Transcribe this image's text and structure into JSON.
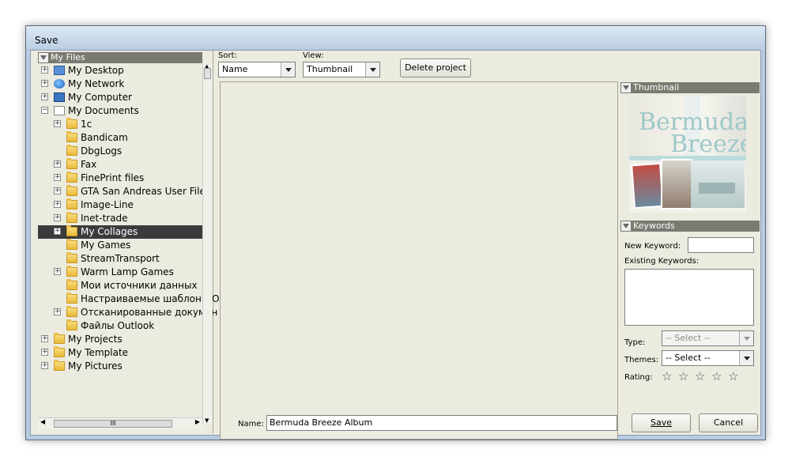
{
  "window": {
    "title": "Save"
  },
  "tree": {
    "header": "My Files",
    "items": [
      {
        "label": "My Desktop",
        "expander": "+",
        "icon": "desktop-icon"
      },
      {
        "label": "My Network",
        "expander": "+",
        "icon": "network-icon"
      },
      {
        "label": "My Computer",
        "expander": "+",
        "icon": "computer-icon"
      },
      {
        "label": "My Documents",
        "expander": "−",
        "icon": "documents-icon"
      },
      {
        "label": "1c",
        "expander": "+",
        "icon": "folder-icon"
      },
      {
        "label": "Bandicam",
        "expander": "",
        "icon": "folder-icon"
      },
      {
        "label": "DbgLogs",
        "expander": "",
        "icon": "folder-icon"
      },
      {
        "label": "Fax",
        "expander": "+",
        "icon": "folder-icon"
      },
      {
        "label": "FinePrint files",
        "expander": "+",
        "icon": "folder-icon"
      },
      {
        "label": "GTA San Andreas User Files",
        "expander": "+",
        "icon": "folder-icon"
      },
      {
        "label": "Image-Line",
        "expander": "+",
        "icon": "folder-icon"
      },
      {
        "label": "Inet-trade",
        "expander": "+",
        "icon": "folder-icon"
      },
      {
        "label": "My Collages",
        "expander": "+",
        "icon": "folder-icon",
        "selected": true
      },
      {
        "label": "My Games",
        "expander": "",
        "icon": "folder-icon"
      },
      {
        "label": "StreamTransport",
        "expander": "",
        "icon": "folder-icon"
      },
      {
        "label": "Warm Lamp Games",
        "expander": "+",
        "icon": "folder-icon"
      },
      {
        "label": "Мои источники данных",
        "expander": "",
        "icon": "folder-icon"
      },
      {
        "label": "Настраиваемые шаблоны O",
        "expander": "",
        "icon": "folder-icon"
      },
      {
        "label": "Отсканированные докумен",
        "expander": "+",
        "icon": "folder-icon"
      },
      {
        "label": "Файлы Outlook",
        "expander": "",
        "icon": "folder-icon"
      },
      {
        "label": "My Projects",
        "expander": "+",
        "icon": "folder-icon"
      },
      {
        "label": "My Template",
        "expander": "+",
        "icon": "folder-icon"
      },
      {
        "label": "My Pictures",
        "expander": "+",
        "icon": "pictures-icon"
      }
    ],
    "hscroll_thumb": "III"
  },
  "toolbar": {
    "sort_label": "Sort:",
    "sort_value": "Name",
    "view_label": "View:",
    "view_value": "Thumbnail",
    "delete_button": "Delete project"
  },
  "thumbnail_panel": {
    "header": "Thumbnail",
    "preview_title_line1": "Bermuda",
    "preview_title_line2": "Breeze"
  },
  "keywords_panel": {
    "header": "Keywords",
    "new_keyword_label": "New Keyword:",
    "new_keyword_value": "",
    "existing_keywords_label": "Existing Keywords:",
    "type_label": "Type:",
    "type_value": "-- Select --",
    "themes_label": "Themes:",
    "themes_value": "-- Select --",
    "rating_label": "Rating:",
    "rating_stars": [
      "☆",
      "☆",
      "☆",
      "☆",
      "☆"
    ]
  },
  "footer": {
    "name_label": "Name:",
    "name_value": "Bermuda Breeze Album",
    "save_button": "Save",
    "cancel_button": "Cancel"
  }
}
